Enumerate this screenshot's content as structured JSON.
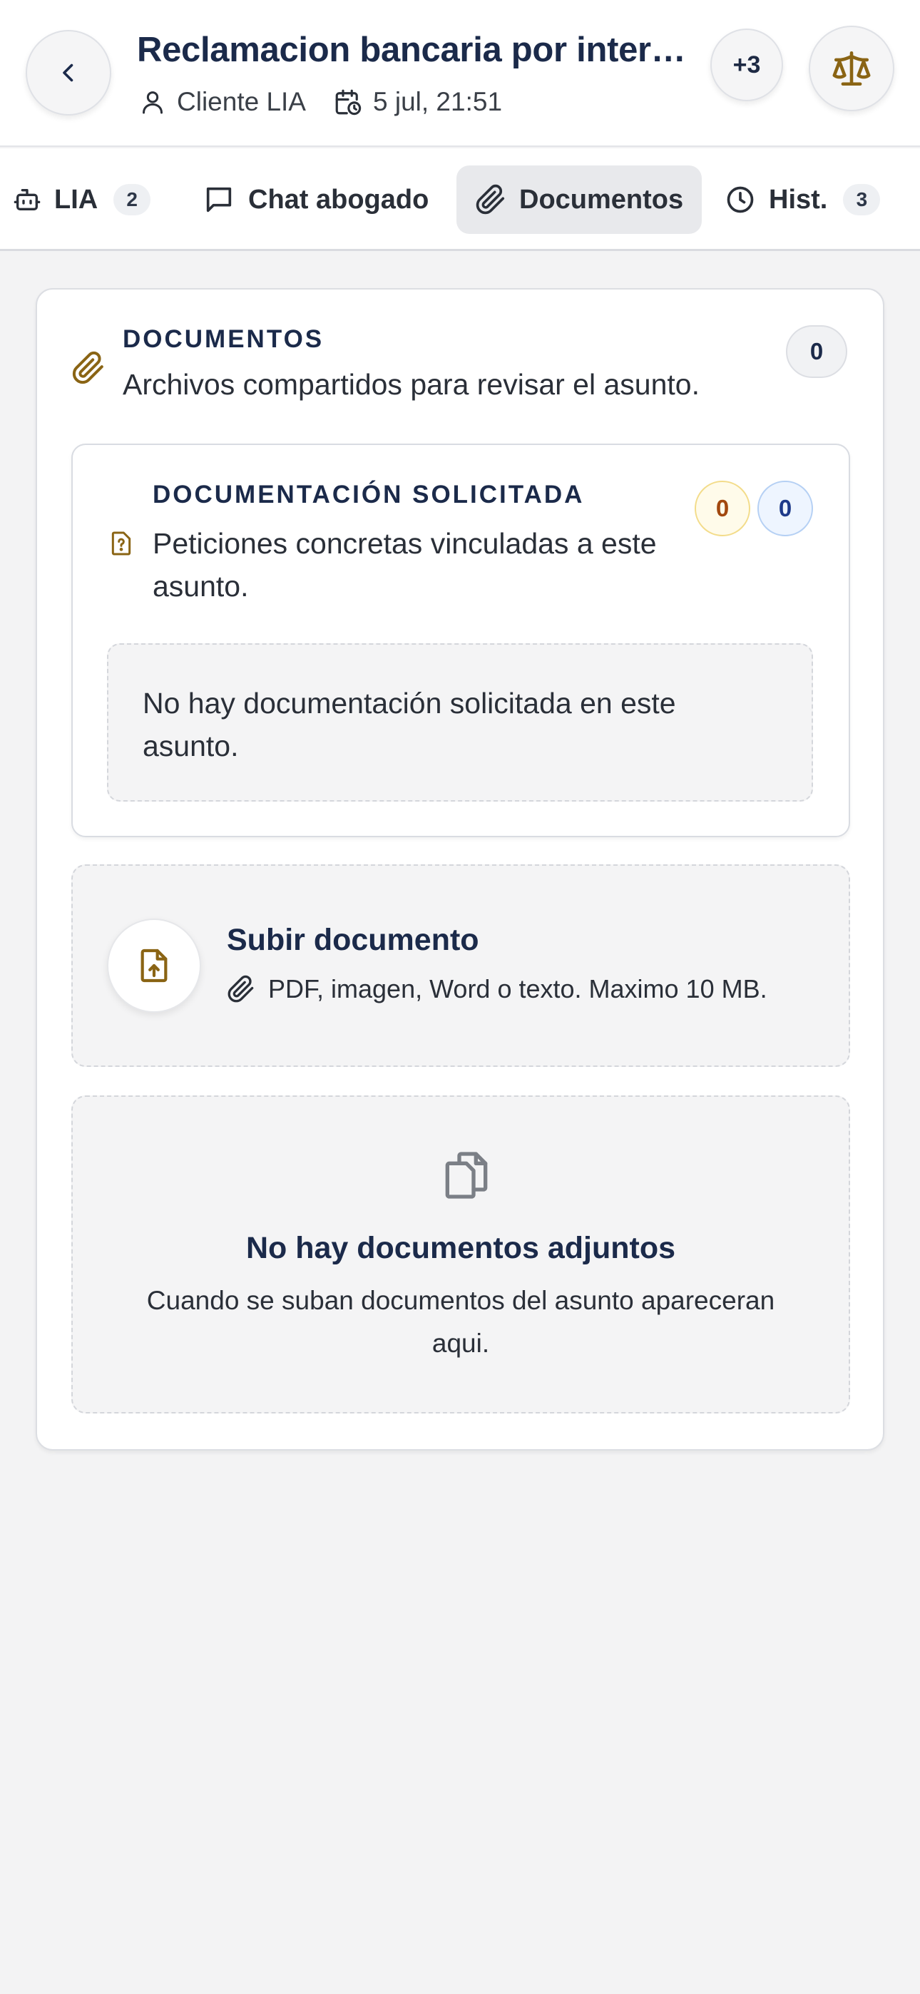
{
  "header": {
    "title": "Reclamacion bancaria por inter…",
    "client_label": "Cliente LIA",
    "date_label": "5 jul, 21:51",
    "more_label": "+3"
  },
  "tabs": [
    {
      "label": "LIA",
      "badge": "2",
      "icon": "robot-icon"
    },
    {
      "label": "Chat abogado",
      "icon": "chat-icon"
    },
    {
      "label": "Documentos",
      "icon": "paperclip-icon",
      "active": true
    },
    {
      "label": "Hist.",
      "badge": "3",
      "icon": "clock-icon"
    }
  ],
  "documents": {
    "eyebrow": "DOCUMENTOS",
    "description": "Archivos compartidos para revisar el asunto.",
    "count": "0"
  },
  "requested": {
    "eyebrow": "DOCUMENTACIÓN SOLICITADA",
    "description": "Peticiones concretas vinculadas a este asunto.",
    "pending_count": "0",
    "received_count": "0",
    "empty_text": "No hay documentación solicitada en este asunto."
  },
  "upload": {
    "title": "Subir documento",
    "hint": "PDF, imagen, Word o texto. Maximo 10 MB."
  },
  "empty_state": {
    "title": "No hay documentos adjuntos",
    "description": "Cuando se suban documentos del asunto apareceran aqui."
  },
  "colors": {
    "navy": "#1b2a4a",
    "gold": "#8a6414",
    "background": "#f3f3f4"
  }
}
